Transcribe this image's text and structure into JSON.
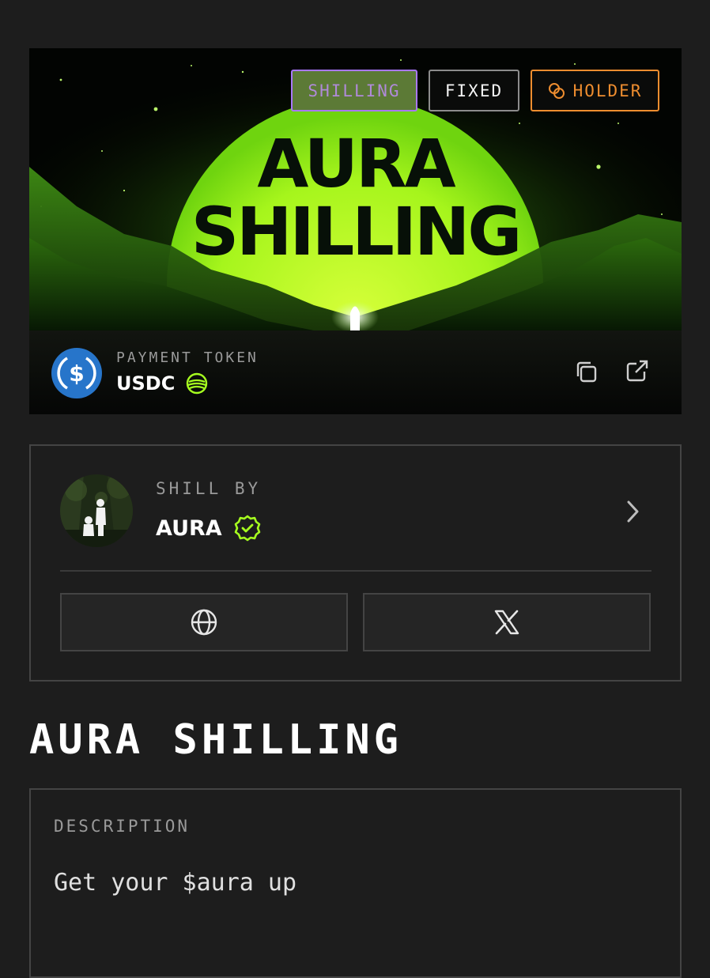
{
  "banner": {
    "title_line1": "AURA",
    "title_line2": "SHILLING",
    "tags": {
      "shilling": "SHILLING",
      "fixed": "FIXED",
      "holder": "HOLDER"
    }
  },
  "payment": {
    "label": "PAYMENT TOKEN",
    "token": "USDC",
    "token_icon": "usdc-icon",
    "chain_icon": "chain-icon"
  },
  "shill": {
    "label": "SHILL BY",
    "name": "AURA",
    "verified_icon": "verified-badge-icon",
    "website_icon": "globe-icon",
    "x_icon": "x-logo-icon"
  },
  "page_title": "AURA SHILLING",
  "description": {
    "label": "DESCRIPTION",
    "text": "Get your $aura up"
  },
  "colors": {
    "background": "#1d1d1d",
    "accent_green": "#a6ff1f",
    "purple": "#a977ff",
    "orange": "#ee8d2f",
    "usdc_blue": "#2775ca"
  }
}
